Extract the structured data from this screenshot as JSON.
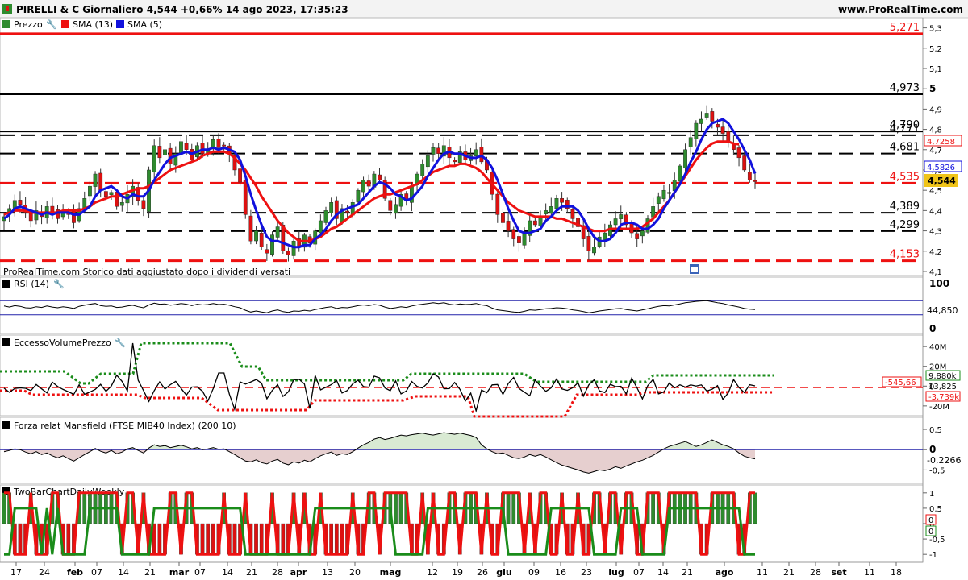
{
  "header": {
    "title": "PIRELLI & C Giornaliero 4,544 +0,66% 14 ago 2023, 17:35:23",
    "site": "www.ProRealTime.com"
  },
  "legend": {
    "price": "Prezzo",
    "sma13": "SMA (13)",
    "sma5": "SMA (5)"
  },
  "footer_note": "ProRealTime.com  Storico dati aggiustato dopo i dividendi versati",
  "colors": {
    "up": "#2e8b2e",
    "down": "#dd1111",
    "sma13": "#ee1111",
    "sma5": "#1111dd",
    "support": "#000000",
    "resistance": "#ee1111"
  },
  "chart_data": [
    {
      "type": "candlestick",
      "panel": "price",
      "x_tick_labels": [
        "17",
        "24",
        "feb",
        "07",
        "14",
        "21",
        "mar",
        "07",
        "14",
        "21",
        "28",
        "apr",
        "13",
        "20",
        "mag",
        "12",
        "19",
        "26",
        "giu",
        "09",
        "16",
        "23",
        "lug",
        "07",
        "14",
        "21",
        "ago",
        "11",
        "21",
        "28",
        "set",
        "11",
        "18"
      ],
      "y_tick_labels": [
        "5,3",
        "5,2",
        "5,1",
        "5",
        "4,9",
        "4,8",
        "4,7",
        "4,6",
        "4,5",
        "4,4",
        "4,3",
        "4,2",
        "4,1"
      ],
      "ylim": [
        4.08,
        5.35
      ],
      "last_price": "4,544",
      "sma13_last": "4,7258",
      "sma5_last": "4,5826",
      "levels": [
        {
          "value": 5.271,
          "label": "5,271",
          "style": "solid",
          "color": "red"
        },
        {
          "value": 4.973,
          "label": "4,973",
          "style": "solid",
          "color": "black"
        },
        {
          "value": 4.79,
          "label": "4,790",
          "style": "solid",
          "color": "black"
        },
        {
          "value": 4.771,
          "label": "4,771",
          "style": "dashed",
          "color": "black"
        },
        {
          "value": 4.681,
          "label": "4,681",
          "style": "dashed",
          "color": "black"
        },
        {
          "value": 4.535,
          "label": "4,535",
          "style": "dashed",
          "color": "red"
        },
        {
          "value": 4.389,
          "label": "4,389",
          "style": "dashed",
          "color": "black"
        },
        {
          "value": 4.299,
          "label": "4,299",
          "style": "dashed",
          "color": "black"
        },
        {
          "value": 4.153,
          "label": "4,153",
          "style": "dashed",
          "color": "red"
        }
      ],
      "close": [
        4.37,
        4.41,
        4.45,
        4.43,
        4.39,
        4.35,
        4.4,
        4.37,
        4.42,
        4.39,
        4.36,
        4.4,
        4.38,
        4.34,
        4.41,
        4.46,
        4.52,
        4.58,
        4.5,
        4.47,
        4.49,
        4.42,
        4.44,
        4.48,
        4.52,
        4.45,
        4.41,
        4.6,
        4.72,
        4.66,
        4.7,
        4.63,
        4.68,
        4.74,
        4.7,
        4.65,
        4.72,
        4.68,
        4.7,
        4.75,
        4.71,
        4.72,
        4.68,
        4.6,
        4.54,
        4.38,
        4.25,
        4.3,
        4.22,
        4.19,
        4.28,
        4.32,
        4.2,
        4.18,
        4.25,
        4.22,
        4.28,
        4.24,
        4.3,
        4.35,
        4.4,
        4.44,
        4.36,
        4.41,
        4.39,
        4.44,
        4.5,
        4.55,
        4.52,
        4.58,
        4.55,
        4.46,
        4.4,
        4.43,
        4.48,
        4.45,
        4.52,
        4.58,
        4.63,
        4.67,
        4.71,
        4.68,
        4.72,
        4.66,
        4.64,
        4.69,
        4.65,
        4.67,
        4.7,
        4.64,
        4.6,
        4.48,
        4.38,
        4.34,
        4.3,
        4.26,
        4.24,
        4.29,
        4.35,
        4.33,
        4.37,
        4.4,
        4.42,
        4.46,
        4.44,
        4.41,
        4.36,
        4.32,
        4.26,
        4.2,
        4.22,
        4.27,
        4.29,
        4.33,
        4.36,
        4.38,
        4.33,
        4.29,
        4.26,
        4.3,
        4.36,
        4.42,
        4.47,
        4.5,
        4.49,
        4.55,
        4.62,
        4.7,
        4.76,
        4.83,
        4.85,
        4.88,
        4.84,
        4.81,
        4.78,
        4.74,
        4.7,
        4.66,
        4.6,
        4.55,
        4.544
      ],
      "sma13": [
        4.38,
        4.39,
        4.4,
        4.4,
        4.4,
        4.39,
        4.39,
        4.39,
        4.39,
        4.39,
        4.39,
        4.4,
        4.4,
        4.4,
        4.4,
        4.41,
        4.42,
        4.44,
        4.45,
        4.46,
        4.47,
        4.47,
        4.48,
        4.49,
        4.5,
        4.51,
        4.51,
        4.52,
        4.54,
        4.56,
        4.58,
        4.6,
        4.61,
        4.62,
        4.63,
        4.64,
        4.65,
        4.67,
        4.68,
        4.69,
        4.69,
        4.69,
        4.68,
        4.66,
        4.63,
        4.6,
        4.56,
        4.52,
        4.47,
        4.43,
        4.39,
        4.35,
        4.32,
        4.29,
        4.27,
        4.25,
        4.25,
        4.25,
        4.26,
        4.27,
        4.29,
        4.31,
        4.32,
        4.34,
        4.36,
        4.38,
        4.4,
        4.42,
        4.44,
        4.46,
        4.47,
        4.48,
        4.48,
        4.49,
        4.5,
        4.51,
        4.52,
        4.53,
        4.55,
        4.57,
        4.59,
        4.6,
        4.61,
        4.62,
        4.62,
        4.63,
        4.63,
        4.62,
        4.61,
        4.59,
        4.56,
        4.53,
        4.5,
        4.47,
        4.44,
        4.42,
        4.4,
        4.39,
        4.38,
        4.37,
        4.37,
        4.37,
        4.37,
        4.36,
        4.36,
        4.35,
        4.34,
        4.33,
        4.32,
        4.31,
        4.3,
        4.3,
        4.3,
        4.31,
        4.31,
        4.31,
        4.31,
        4.31,
        4.31,
        4.32,
        4.34,
        4.36,
        4.39,
        4.42,
        4.45,
        4.49,
        4.53,
        4.57,
        4.61,
        4.65,
        4.68,
        4.71,
        4.73,
        4.74,
        4.74,
        4.74,
        4.73,
        4.7258
      ],
      "sma5": [
        4.36,
        4.38,
        4.41,
        4.42,
        4.41,
        4.4,
        4.39,
        4.38,
        4.39,
        4.38,
        4.39,
        4.39,
        4.39,
        4.38,
        4.38,
        4.4,
        4.42,
        4.47,
        4.5,
        4.51,
        4.52,
        4.5,
        4.47,
        4.46,
        4.48,
        4.47,
        4.47,
        4.5,
        4.55,
        4.59,
        4.63,
        4.66,
        4.67,
        4.68,
        4.69,
        4.68,
        4.69,
        4.7,
        4.7,
        4.71,
        4.7,
        4.71,
        4.7,
        4.69,
        4.65,
        4.57,
        4.48,
        4.4,
        4.33,
        4.27,
        4.25,
        4.25,
        4.24,
        4.23,
        4.22,
        4.22,
        4.23,
        4.23,
        4.26,
        4.28,
        4.31,
        4.35,
        4.38,
        4.4,
        4.41,
        4.42,
        4.43,
        4.46,
        4.49,
        4.52,
        4.54,
        4.53,
        4.51,
        4.48,
        4.47,
        4.45,
        4.46,
        4.49,
        4.52,
        4.57,
        4.61,
        4.65,
        4.68,
        4.69,
        4.68,
        4.68,
        4.67,
        4.66,
        4.66,
        4.67,
        4.65,
        4.61,
        4.55,
        4.48,
        4.41,
        4.35,
        4.3,
        4.29,
        4.29,
        4.3,
        4.31,
        4.35,
        4.37,
        4.4,
        4.42,
        4.42,
        4.42,
        4.4,
        4.36,
        4.31,
        4.27,
        4.25,
        4.25,
        4.26,
        4.29,
        4.33,
        4.34,
        4.34,
        4.33,
        4.31,
        4.31,
        4.33,
        4.36,
        4.41,
        4.45,
        4.49,
        4.53,
        4.58,
        4.64,
        4.69,
        4.75,
        4.8,
        4.83,
        4.84,
        4.85,
        4.83,
        4.79,
        4.75,
        4.7,
        4.65,
        4.5826
      ]
    },
    {
      "type": "line",
      "panel": "rsi",
      "name": "RSI (14)",
      "y_tick_labels": [
        "100",
        "0"
      ],
      "ylim": [
        0,
        100
      ],
      "bands": [
        70,
        30
      ],
      "last_label": "44,850",
      "values": [
        55,
        52,
        56,
        54,
        50,
        49,
        53,
        51,
        55,
        52,
        50,
        53,
        51,
        48,
        54,
        57,
        60,
        62,
        56,
        54,
        55,
        51,
        52,
        55,
        57,
        53,
        50,
        58,
        63,
        60,
        61,
        57,
        59,
        62,
        60,
        56,
        60,
        58,
        59,
        62,
        59,
        60,
        57,
        53,
        50,
        43,
        38,
        41,
        38,
        36,
        41,
        44,
        39,
        37,
        41,
        40,
        43,
        41,
        45,
        48,
        51,
        53,
        48,
        51,
        50,
        53,
        56,
        58,
        56,
        59,
        57,
        52,
        48,
        50,
        53,
        51,
        55,
        58,
        60,
        62,
        64,
        62,
        64,
        60,
        58,
        61,
        59,
        60,
        62,
        58,
        56,
        49,
        44,
        42,
        40,
        38,
        37,
        40,
        44,
        43,
        45,
        47,
        48,
        50,
        49,
        47,
        44,
        42,
        39,
        36,
        38,
        41,
        43,
        45,
        47,
        48,
        45,
        43,
        41,
        44,
        47,
        51,
        54,
        56,
        55,
        58,
        61,
        64,
        66,
        68,
        69,
        70,
        67,
        64,
        62,
        58,
        55,
        52,
        48,
        46,
        44.85
      ]
    },
    {
      "type": "line",
      "panel": "eccesso",
      "name": "EccessoVolumePrezzo",
      "y_tick_labels": [
        "40M",
        "20M",
        "0",
        "-20M"
      ],
      "ylim": [
        -25,
        45
      ],
      "last_labels": [
        "-545,66",
        "9,880k",
        "13,825",
        "-3,739k"
      ]
    },
    {
      "type": "area",
      "panel": "mansfield",
      "name": "Forza relat Mansfield (FTSE MIB40 Index) (200 10)",
      "y_tick_labels": [
        "0,5",
        "0",
        "-0,5"
      ],
      "ylim": [
        -0.75,
        0.6
      ],
      "last_label": "-0,2266",
      "values": [
        -0.05,
        -0.02,
        0.02,
        0.0,
        -0.06,
        -0.1,
        -0.05,
        -0.12,
        -0.08,
        -0.15,
        -0.2,
        -0.15,
        -0.22,
        -0.28,
        -0.2,
        -0.12,
        -0.05,
        0.03,
        -0.04,
        -0.08,
        -0.02,
        -0.1,
        -0.06,
        0.02,
        0.05,
        -0.02,
        -0.08,
        0.04,
        0.12,
        0.08,
        0.1,
        0.05,
        0.08,
        0.11,
        0.07,
        0.02,
        0.05,
        0.0,
        0.02,
        0.05,
        0.01,
        0.02,
        -0.05,
        -0.12,
        -0.2,
        -0.28,
        -0.3,
        -0.25,
        -0.32,
        -0.35,
        -0.28,
        -0.24,
        -0.33,
        -0.37,
        -0.3,
        -0.33,
        -0.26,
        -0.3,
        -0.22,
        -0.15,
        -0.1,
        -0.06,
        -0.14,
        -0.1,
        -0.12,
        -0.05,
        0.04,
        0.12,
        0.18,
        0.26,
        0.3,
        0.25,
        0.28,
        0.32,
        0.36,
        0.34,
        0.37,
        0.39,
        0.41,
        0.38,
        0.36,
        0.39,
        0.42,
        0.4,
        0.38,
        0.41,
        0.38,
        0.35,
        0.3,
        0.12,
        0.02,
        -0.05,
        -0.1,
        -0.08,
        -0.14,
        -0.2,
        -0.22,
        -0.18,
        -0.12,
        -0.16,
        -0.12,
        -0.18,
        -0.25,
        -0.32,
        -0.38,
        -0.42,
        -0.46,
        -0.5,
        -0.55,
        -0.58,
        -0.54,
        -0.5,
        -0.52,
        -0.48,
        -0.42,
        -0.46,
        -0.4,
        -0.35,
        -0.3,
        -0.26,
        -0.2,
        -0.14,
        -0.06,
        0.02,
        0.08,
        0.12,
        0.16,
        0.2,
        0.14,
        0.08,
        0.12,
        0.18,
        0.24,
        0.18,
        0.12,
        0.08,
        0.02,
        -0.08,
        -0.16,
        -0.2,
        -0.2266
      ]
    },
    {
      "type": "bar",
      "panel": "twobar",
      "name": "TwoBarChartDailyWeekly",
      "y_tick_labels": [
        "1",
        "0,5",
        "0",
        "-0,5",
        "-1"
      ],
      "ylim": [
        -1.1,
        1.1
      ],
      "last_labels": [
        "0",
        "0"
      ]
    }
  ]
}
